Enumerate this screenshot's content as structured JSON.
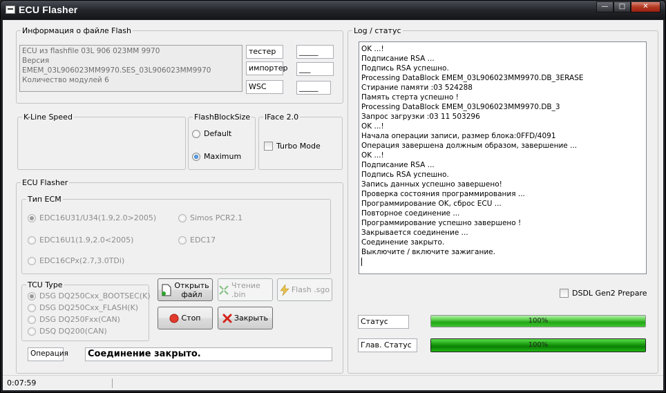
{
  "window": {
    "title": "ECU Flasher"
  },
  "info_group": {
    "legend": "Информация  о файле Flash",
    "lines": [
      "ECU из flashfile 03L 906 023MM 9970",
      "Версия EMEM_03L906023MM9970.SES_03L906023MM9970",
      "Количество модулей 6"
    ],
    "fields": [
      {
        "label": "тестер",
        "value": "_____"
      },
      {
        "label": "импортер",
        "value": "___"
      },
      {
        "label": "WSC",
        "value": "_____"
      }
    ]
  },
  "kline": {
    "legend": "K-Line Speed"
  },
  "flashblock": {
    "legend": "FlashBlockSize",
    "options": [
      {
        "label": "Default",
        "selected": false
      },
      {
        "label": "Maximum",
        "selected": true
      }
    ]
  },
  "iface": {
    "legend": "IFace 2.0",
    "turbo_label": "Turbo Mode",
    "turbo_checked": false
  },
  "ecu_flasher": {
    "legend": "ECU Flasher",
    "ecm_legend": "Тип ECM",
    "ecm_options": [
      {
        "label": "EDC16U31/U34(1.9,2.0>2005)",
        "selected": true
      },
      {
        "label": "Simos PCR2.1",
        "selected": false
      },
      {
        "label": "EDC16U1(1.9,2.0<2005)",
        "selected": false
      },
      {
        "label": "EDC17",
        "selected": false
      },
      {
        "label": "EDC16CPx(2.7,3.0TDi)",
        "selected": false
      }
    ],
    "tcu_legend": "TCU Type",
    "tcu_options": [
      {
        "label": "DSG DQ250Cxx_BOOTSEC(K)",
        "selected": true
      },
      {
        "label": "DSG DQ250Cxx_FLASH(K)",
        "selected": false
      },
      {
        "label": "DSG DQ250Fxx(CAN)",
        "selected": false
      },
      {
        "label": "DSQ DQ200(CAN)",
        "selected": false
      }
    ],
    "buttons": {
      "open_line1": "Открыть",
      "open_line2": "файл",
      "read": "Чтение .bin",
      "flash": "Flash .sgo",
      "stop": "Стоп",
      "close": "Закрыть"
    },
    "operation_label": "Операция",
    "operation_text": "Соединение закрыто."
  },
  "log": {
    "legend": "Log / статус",
    "lines": [
      "OK ...!",
      "Подписание RSA ...",
      "Подпись RSA успешно.",
      "Processing DataBlock EMEM_03L906023MM9970.DB_3ERASE",
      "Стирание памяти :03 524288",
      "Память стерта успешно !",
      "Processing DataBlock EMEM_03L906023MM9970.DB_3",
      "Запрос загрузки :03 11 503296",
      "OK ...!",
      "Начала операции записи, размер блока:0FFD/4091",
      "Операция завершена должным образом, завершение ...",
      "OK ...!",
      "Подписание RSA ...",
      "Подпись RSA успешно.",
      "Запись данных успешно завершено!",
      "Проверка состояния программирования ...",
      "Программирование OK, сброс ECU ...",
      "Повторное соединение ...",
      "Программирование успешно завершено !",
      "Закрывается соединение ...",
      "Соединение закрыто.",
      "Выключите / включите зажигание."
    ]
  },
  "dsdl": {
    "label": "DSDL Gen2 Prepare",
    "checked": false
  },
  "progress": {
    "status_label": "Статус",
    "status_text": "100%",
    "status_value": 100,
    "main_label": "Глав. Статус",
    "main_text": "100%",
    "main_value": 100
  },
  "statusbar": {
    "time": "0:07:59"
  },
  "colors": {
    "progress_green": "#23a516",
    "titlebar": "#24262b"
  }
}
